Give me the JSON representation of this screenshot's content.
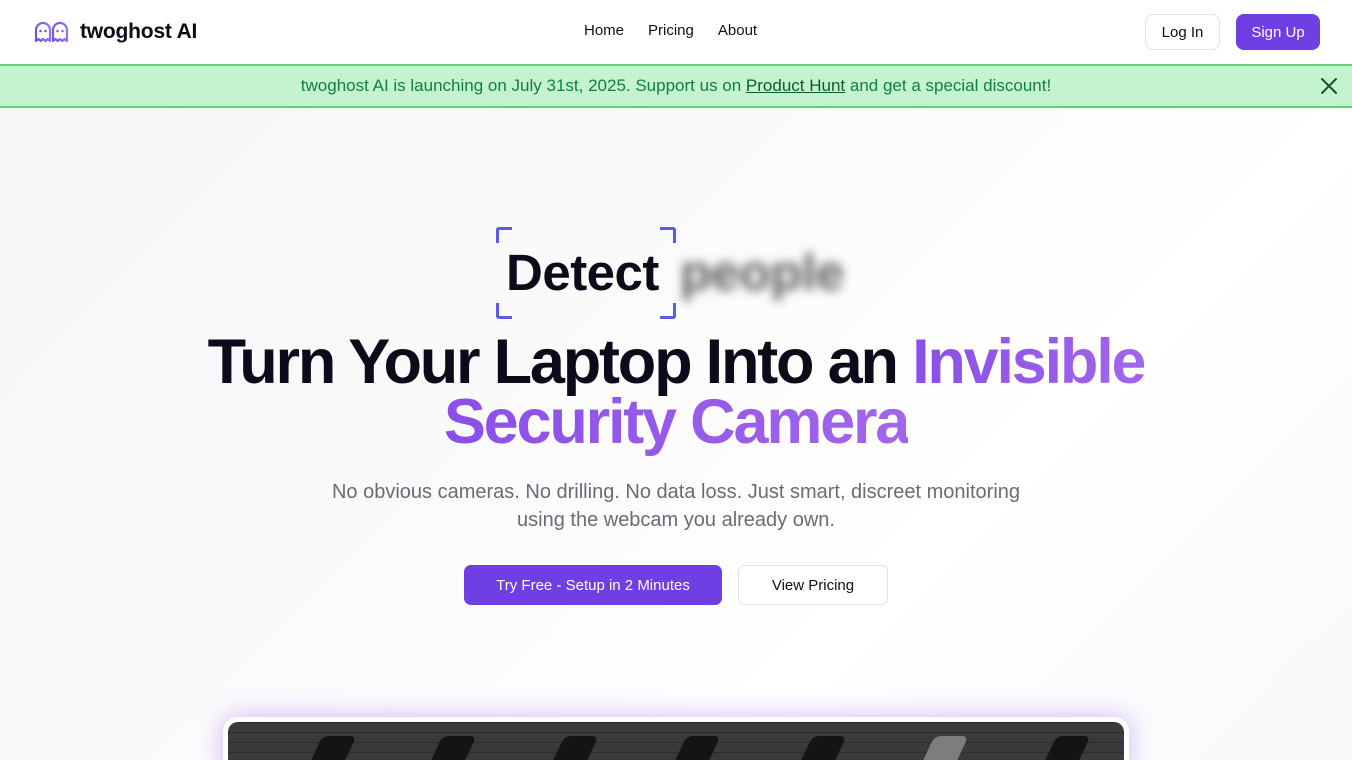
{
  "header": {
    "brand": "twoghost AI",
    "nav": [
      "Home",
      "Pricing",
      "About"
    ],
    "login_label": "Log In",
    "signup_label": "Sign Up"
  },
  "banner": {
    "text_before": "twoghost AI is launching on July 31st, 2025. Support us on ",
    "link_text": "Product Hunt",
    "text_after": " and get a special discount!"
  },
  "hero": {
    "detect_word": "Detect",
    "detect_blurred_word": "people",
    "headline_plain": "Turn Your Laptop Into an ",
    "headline_accent_1": "Invisible",
    "headline_accent_2": "Security Camera",
    "subtitle": "No obvious cameras. No drilling. No data loss. Just smart, discreet monitoring using the webcam you already own.",
    "cta_primary": "Try Free - Setup in 2 Minutes",
    "cta_secondary": "View Pricing"
  },
  "colors": {
    "brand_purple": "#6f3fe4",
    "accent_gradient_start": "#8a4fe8",
    "banner_green": "#c3f3cf",
    "banner_text": "#15803d"
  },
  "icons": {
    "logo": "ghost-pair-icon",
    "close": "close-icon"
  }
}
